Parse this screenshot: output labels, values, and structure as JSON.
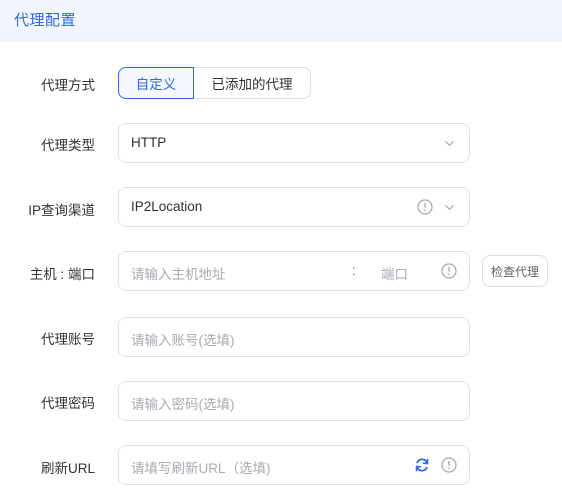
{
  "header": {
    "title": "代理配置"
  },
  "form": {
    "mode": {
      "label": "代理方式",
      "options": [
        "自定义",
        "已添加的代理"
      ],
      "selected": "自定义"
    },
    "type": {
      "label": "代理类型",
      "value": "HTTP"
    },
    "ip_channel": {
      "label": "IP查询渠道",
      "value": "IP2Location"
    },
    "host": {
      "label": "主机 : 端口",
      "host_placeholder": "请输入主机地址",
      "separator": ":",
      "port_placeholder": "端口",
      "check_button": "检查代理"
    },
    "account": {
      "label": "代理账号",
      "placeholder": "请输入账号(选填)"
    },
    "password": {
      "label": "代理密码",
      "placeholder": "请输入密码(选填)"
    },
    "refresh_url": {
      "label": "刷新URL",
      "placeholder": "请填写刷新URL（选填)"
    }
  },
  "colors": {
    "accent": "#2f6ad8",
    "border": "#dcdfe6",
    "header_bg": "#f2f5fc",
    "icon": "#a8abb2"
  },
  "icons": [
    "chevron-down-icon",
    "info-icon",
    "refresh-icon"
  ]
}
